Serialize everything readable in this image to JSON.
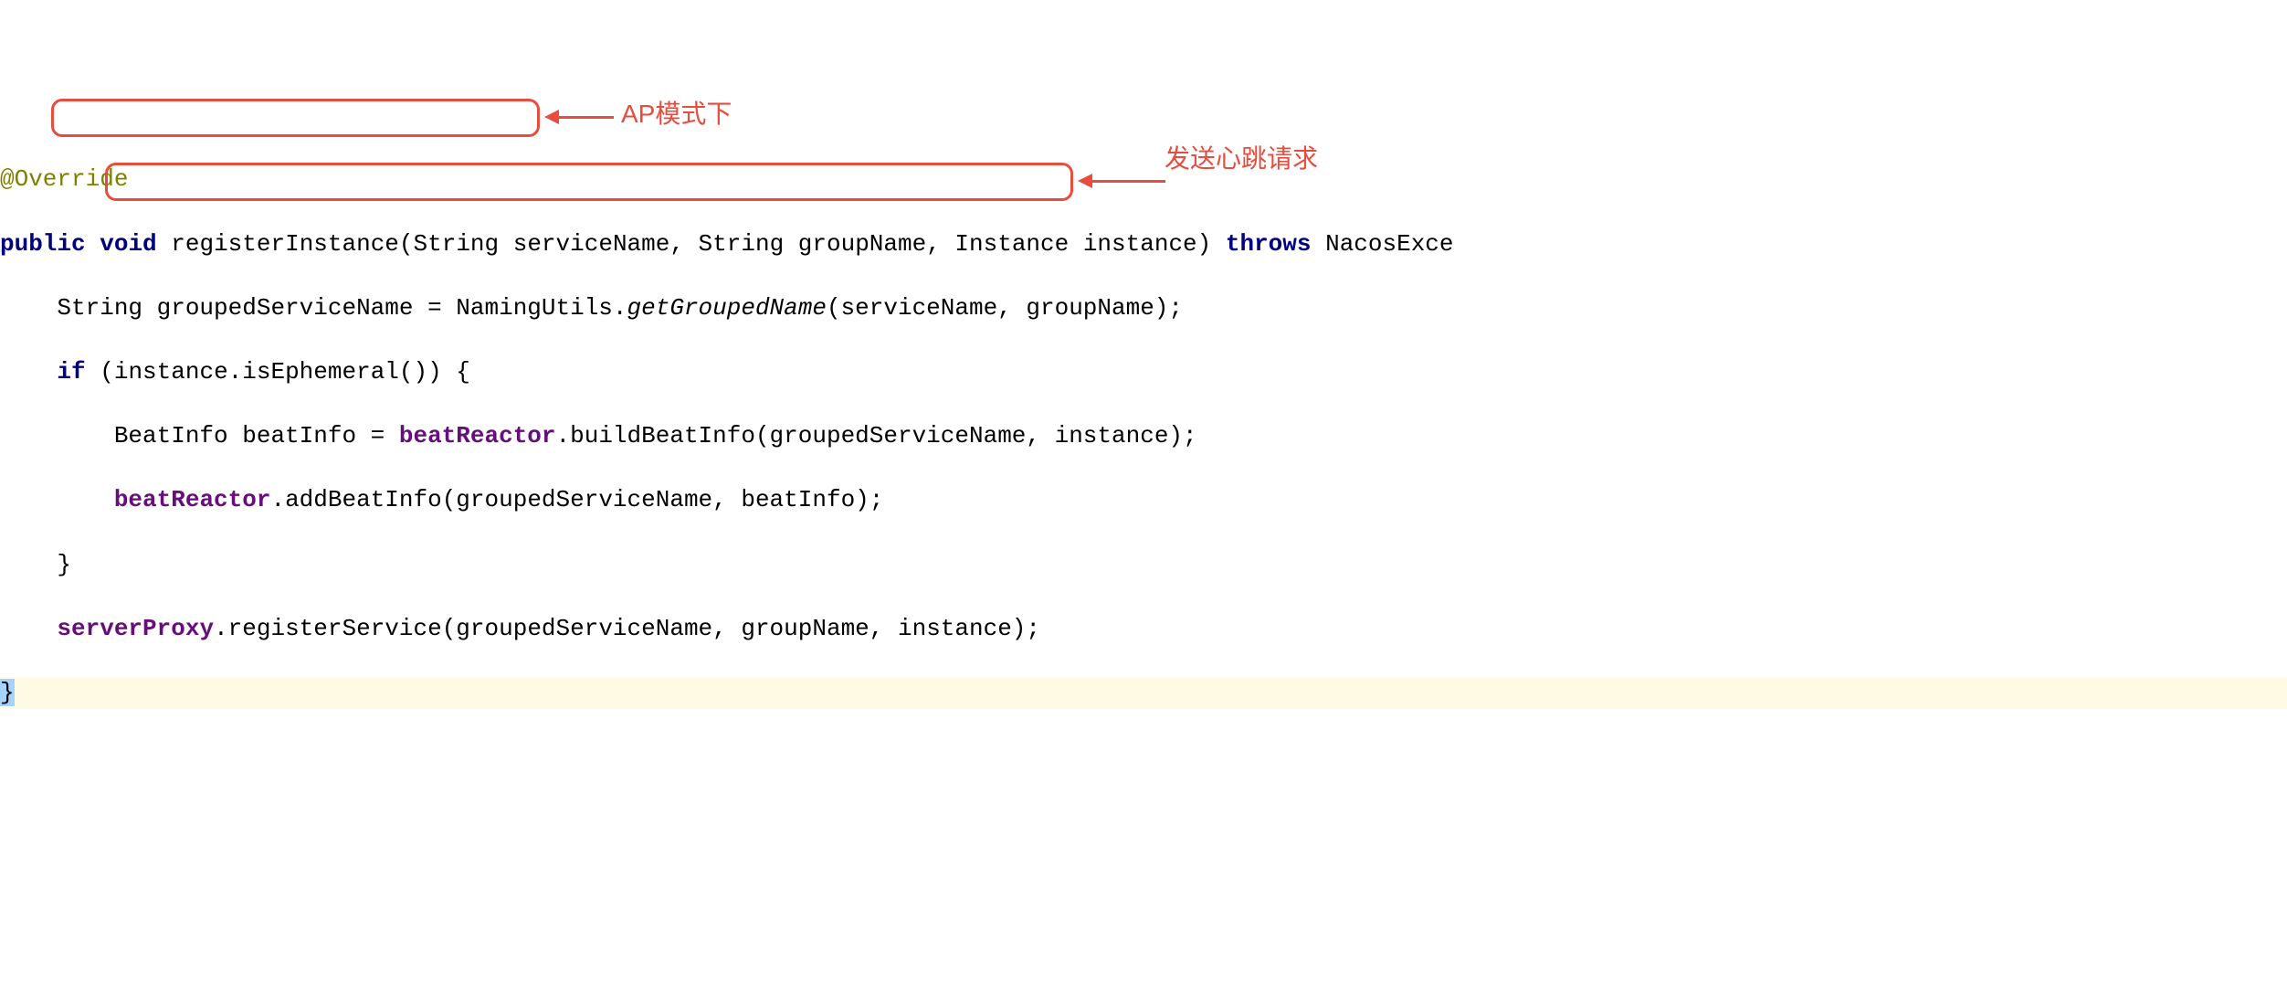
{
  "code": {
    "line1": "@Override",
    "line2_public": "public",
    "line2_void": "void",
    "line2_method": "registerInstance(String serviceName, String groupName, Instance instance) ",
    "line2_throws": "throws",
    "line2_exc": " NacosExce",
    "line3_pre": "    String groupedServiceName = NamingUtils.",
    "line3_static": "getGroupedName",
    "line3_post": "(serviceName, groupName);",
    "line4_indent": "    ",
    "line4_if": "if",
    "line4_cond": " (instance.isEphemeral()) {",
    "line5_pre": "        BeatInfo beatInfo = ",
    "line5_field": "beatReactor",
    "line5_post": ".buildBeatInfo(groupedServiceName, instance);",
    "line6_indent": "        ",
    "line6_field": "beatReactor",
    "line6_post": ".addBeatInfo(groupedServiceName, beatInfo);",
    "line7": "    }",
    "line8_indent": "    ",
    "line8_field": "serverProxy",
    "line8_post": ".registerService(groupedServiceName, groupName, instance);",
    "line9": "}"
  },
  "annotations": {
    "ap_mode": "AP模式下",
    "heartbeat": "发送心跳请求"
  }
}
